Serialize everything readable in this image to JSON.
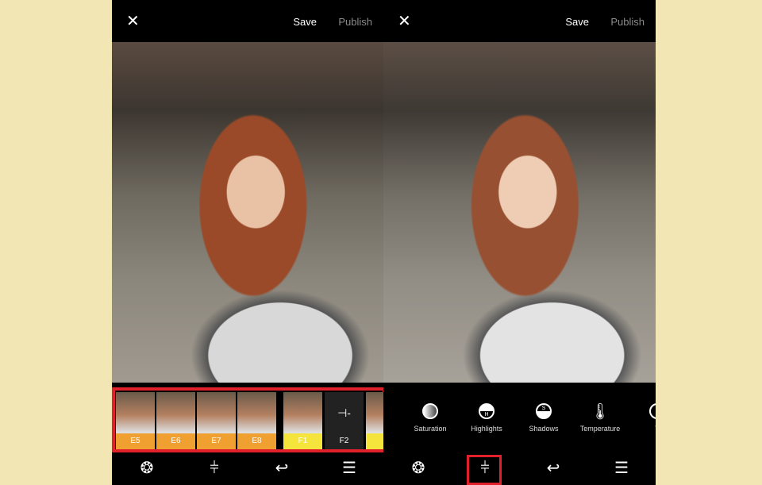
{
  "left_screen": {
    "top_bar": {
      "close_icon": "✕",
      "save": "Save",
      "publish": "Publish"
    },
    "filters": [
      {
        "label": "E5",
        "color": "#f0a030"
      },
      {
        "label": "E6",
        "color": "#f0a030"
      },
      {
        "label": "E7",
        "color": "#f0a030"
      },
      {
        "label": "E8",
        "color": "#f0a030"
      },
      {
        "label": "F1",
        "color": "#f4e43c"
      },
      {
        "label": "F2",
        "color": "#222222"
      }
    ],
    "toolbar": [
      "presets-wheel-icon",
      "adjust-sliders-icon",
      "undo-icon",
      "list-icon"
    ]
  },
  "right_screen": {
    "top_bar": {
      "close_icon": "✕",
      "save": "Save",
      "publish": "Publish"
    },
    "tools": [
      {
        "label": "Saturation"
      },
      {
        "label": "Highlights",
        "glyph": "H"
      },
      {
        "label": "Shadows",
        "glyph": "S"
      },
      {
        "label": "Temperature"
      },
      {
        "label": "T"
      }
    ],
    "toolbar": [
      "presets-wheel-icon",
      "adjust-sliders-icon",
      "undo-icon",
      "list-icon"
    ]
  },
  "colors": {
    "background": "#f2e6b5",
    "highlight": "#e0202a"
  }
}
